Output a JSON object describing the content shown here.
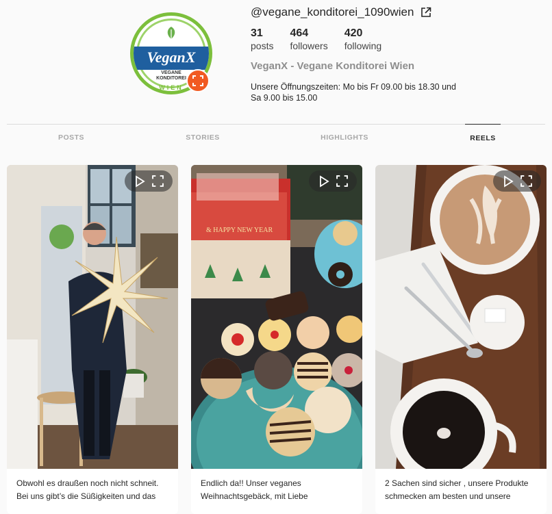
{
  "profile": {
    "username": "@vegane_konditorei_1090wien",
    "avatar": {
      "brand": "VeganX",
      "subline1": "VEGANE",
      "subline2": "KONDITOREI",
      "city": "WIEN"
    },
    "stats": [
      {
        "value": "31",
        "label": "posts"
      },
      {
        "value": "464",
        "label": "followers"
      },
      {
        "value": "420",
        "label": "following"
      }
    ],
    "full_name": "VeganX - Vegane Konditorei Wien",
    "bio": "Unsere Öffnungszeiten: Mo bis Fr 09.00 bis 18.30 und Sa 9.00 bis 15.00"
  },
  "tabs": [
    {
      "label": "POSTS",
      "active": false
    },
    {
      "label": "STORIES",
      "active": false
    },
    {
      "label": "HIGHLIGHTS",
      "active": false
    },
    {
      "label": "REELS",
      "active": true
    }
  ],
  "reels": [
    {
      "caption_line1": "Obwohl es draußen noch nicht schneit.",
      "caption_line2": "Bei uns gibt’s die Süßigkeiten und das",
      "thumbnail": "man-with-star-lamp"
    },
    {
      "caption_line1": "Endlich da!! Unser veganes",
      "caption_line2": "Weihnachtsgebäck, mit Liebe",
      "thumbnail": "christmas-cookies-plate",
      "box_text": "& HAPPY NEW YEAR"
    },
    {
      "caption_line1": "2 Sachen sind sicher , unsere Produkte",
      "caption_line2": "schmecken am besten und unsere",
      "thumbnail": "coffee-cups-tray"
    }
  ],
  "colors": {
    "accent": "#f15a22",
    "brand_green": "#7cbf3c",
    "brand_blue": "#1f5f9f"
  },
  "icons": {
    "external_link": "external-link-icon",
    "play": "play-icon",
    "expand": "expand-icon"
  }
}
